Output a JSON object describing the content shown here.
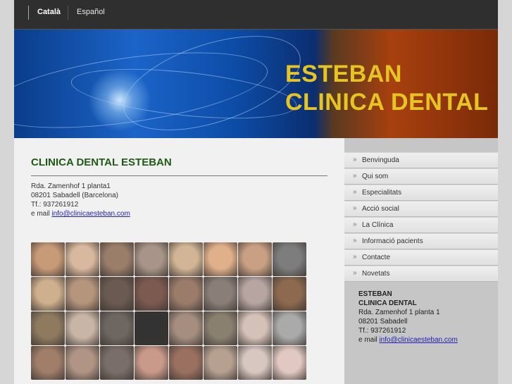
{
  "languages": [
    {
      "label": "Català",
      "active": true
    },
    {
      "label": "Español",
      "active": false
    }
  ],
  "header": {
    "line1": "ESTEBAN",
    "line2": "CLINICA DENTAL"
  },
  "content": {
    "title": "CLINICA DENTAL ESTEBAN",
    "address_line1": "Rda. Zamenhof 1 planta1",
    "address_line2": "08201 Sabadell (Barcelona)",
    "phone": "Tf.: 937261912",
    "email_prefix": "e mail ",
    "email": "info@clinicaesteban.com"
  },
  "menu": [
    {
      "label": "Benvinguda"
    },
    {
      "label": "Qui som"
    },
    {
      "label": "Especialitats"
    },
    {
      "label": "Acció social"
    },
    {
      "label": "La Clínica"
    },
    {
      "label": "Informació pacients"
    },
    {
      "label": "Contacte"
    },
    {
      "label": "Novetats"
    }
  ],
  "sidebar_card": {
    "name1": "ESTEBAN",
    "name2": "CLINICA DENTAL",
    "address_line1": "Rda. Zamenhof 1 planta 1",
    "address_line2": "08201 Sabadell",
    "phone": "Tf.: 937261912",
    "email_prefix": "e mail ",
    "email": "info@clinicaesteban.com"
  },
  "photo_grid": {
    "rows": 4,
    "cols": 8,
    "colors": [
      "#c79a78",
      "#d8b89e",
      "#9a7e6a",
      "#a89488",
      "#d2b596",
      "#e0b08a",
      "#caa084",
      "#7d7d7d",
      "#cfb08e",
      "#b6957d",
      "#6a5a52",
      "#7c5a50",
      "#9b7c6a",
      "#8a7f78",
      "#b6a5a0",
      "#8d6a4f",
      "#8f7a60",
      "#c9b5a6",
      "#6e6660",
      "#333333",
      "#a58d80",
      "#8a8070",
      "#d4c2b8",
      "#aaaaaa",
      "#a07e6a",
      "#b09584",
      "#7a6e6a",
      "#c99a8a",
      "#9a7060",
      "#b6a090",
      "#d8c6c0",
      "#e2c8c2"
    ]
  }
}
